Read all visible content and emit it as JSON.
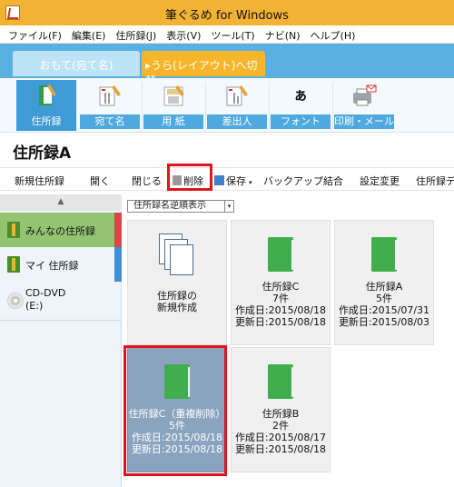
{
  "window": {
    "title": "筆ぐるめ for Windows"
  },
  "menu": [
    "ファイル(F)",
    "編集(E)",
    "住所録(J)",
    "表示(V)",
    "ツール(T)",
    "ナビ(N)",
    "ヘルプ(H)"
  ],
  "mode": {
    "omote": "おもて(宛て名)",
    "ura": "▸うら(レイアウト)へ切替"
  },
  "ribbon": {
    "items": [
      {
        "label": "住所録",
        "icon": "address-book-icon"
      },
      {
        "label": "宛て名",
        "icon": "recipient-card-icon"
      },
      {
        "label": "用 紙",
        "icon": "paper-icon"
      },
      {
        "label": "差出人",
        "icon": "sender-card-icon"
      },
      {
        "label": "フォント",
        "icon": "font-icon",
        "glyph": "ぁあ"
      },
      {
        "label": "印刷・メール",
        "icon": "printer-icon"
      }
    ]
  },
  "page": {
    "title": "住所録A"
  },
  "toolbar": {
    "new": "新規住所録",
    "open": "開く",
    "close": "閉じる",
    "delete": "削除",
    "save": "保存",
    "backup": "バックアップ",
    "merge": "結合",
    "settings": "設定変更",
    "more": "住所録デ"
  },
  "sidebar": {
    "scroll_up": "▲",
    "items": [
      {
        "label": "みんなの住所録",
        "accent": "#d84848"
      },
      {
        "label": "マイ 住所録",
        "accent": "#3f8fd6"
      },
      {
        "label": "CD-DVD",
        "label2": "(E:)"
      }
    ]
  },
  "sort": {
    "value": "住所録名逆順表示",
    "arrow": "▾"
  },
  "cards": [
    {
      "kind": "new",
      "line1": "住所録の",
      "line2": "新規作成"
    },
    {
      "kind": "book",
      "name": "住所録C",
      "count": "7件",
      "created": "作成日:2015/08/18",
      "updated": "更新日:2015/08/18"
    },
    {
      "kind": "book",
      "name": "住所録A",
      "count": "5件",
      "created": "作成日:2015/07/31",
      "updated": "更新日:2015/08/03"
    },
    {
      "kind": "book",
      "name": "住所録C（重複削除）",
      "count": "5件",
      "created": "作成日:2015/08/18",
      "updated": "更新日:2015/08/18",
      "selected": true
    },
    {
      "kind": "book",
      "name": "住所録B",
      "count": "2件",
      "created": "作成日:2015/08/17",
      "updated": "更新日:2015/08/18"
    }
  ]
}
